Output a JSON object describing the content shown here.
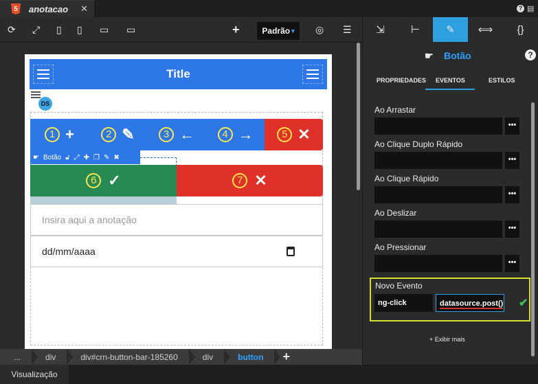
{
  "tab": {
    "badge": "5",
    "title": "anotacao",
    "close": "✕"
  },
  "top_right": {
    "help": "?"
  },
  "toolbar": {
    "preset": "Padrão",
    "caret": "▾",
    "add": "+"
  },
  "navbar": {
    "title": "Title"
  },
  "datasource": {
    "badge": "DS"
  },
  "button_bar": {
    "buttons": [
      {
        "num": "1",
        "glyph": "+",
        "color": "#2e77e6"
      },
      {
        "num": "2",
        "glyph": "✎",
        "color": "#2e77e6"
      },
      {
        "num": "3",
        "glyph": "←",
        "color": "#2e77e6"
      },
      {
        "num": "4",
        "glyph": "→",
        "color": "#2e77e6"
      },
      {
        "num": "5",
        "glyph": "✕",
        "color": "#e0302a"
      }
    ]
  },
  "selection": {
    "label": "Botão"
  },
  "row2": {
    "confirm": {
      "num": "6",
      "glyph": "✓",
      "color": "#268a52"
    },
    "cancel": {
      "num": "7",
      "glyph": "✕",
      "color": "#e0302a"
    }
  },
  "form": {
    "annotation_placeholder": "Insira aqui a anotação",
    "date_placeholder": "dd/mm/aaaa"
  },
  "breadcrumb": [
    "...",
    "div",
    "div#crn-button-bar-185260",
    "div",
    "button"
  ],
  "bottom": {
    "tab": "Visualização"
  },
  "panel": {
    "component": "Botão",
    "help": "?",
    "tabs": [
      "PROPRIEDADES",
      "EVENTOS",
      "ESTILOS"
    ],
    "active_tab": "EVENTOS",
    "events": [
      {
        "label": "Ao Arrastar",
        "value": ""
      },
      {
        "label": "Ao Clique Duplo Rápido",
        "value": ""
      },
      {
        "label": "Ao Clique Rápido",
        "value": ""
      },
      {
        "label": "Ao Deslizar",
        "value": ""
      },
      {
        "label": "Ao Pressionar",
        "value": ""
      }
    ],
    "more_button": "•••",
    "new_event": {
      "label": "Novo Evento",
      "key": "ng-click",
      "value": "datasource.post()",
      "confirm": "✔"
    },
    "show_more": "+ Exibir mais"
  },
  "colors": {
    "accent": "#2ea0e0",
    "highlight_border": "#d7dc2e",
    "navbar": "#2e77e6"
  }
}
